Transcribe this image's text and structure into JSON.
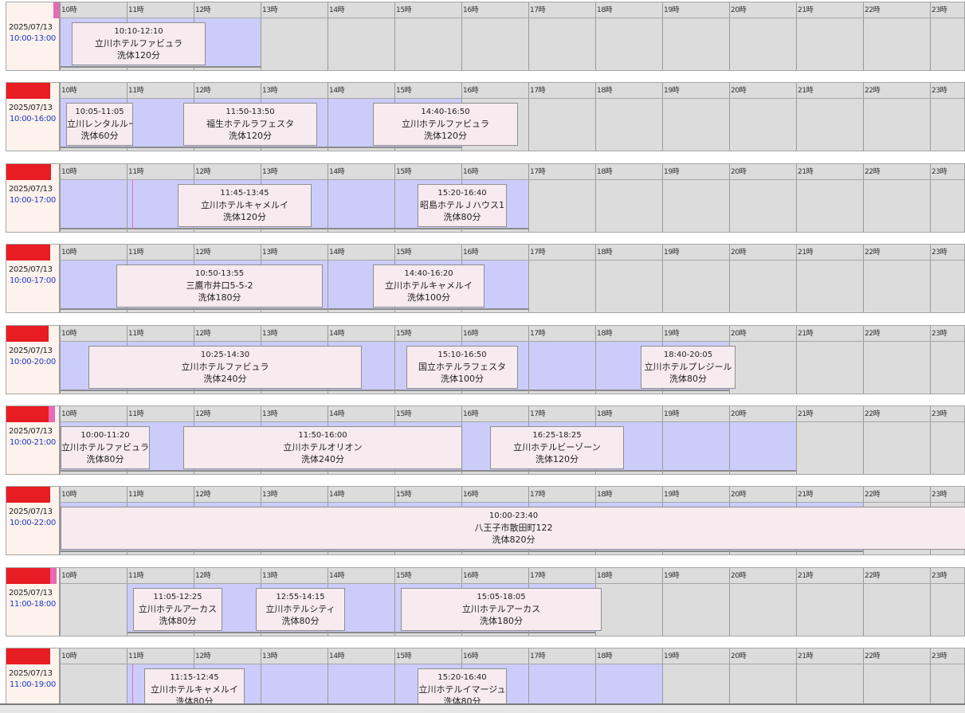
{
  "colors": {
    "available": "#ccccfb",
    "job": "#f7ebef",
    "name_bar": "#e81c23",
    "time_text": "#1e38c8"
  },
  "hours": [
    "10時",
    "11時",
    "12時",
    "13時",
    "14時",
    "15時",
    "16時",
    "17時",
    "18時",
    "19時",
    "20時",
    "21時",
    "22時",
    "23時"
  ],
  "staff": [
    {
      "date": "2025/07/13",
      "shift": "10:00-13:00",
      "name_bar": false,
      "jobs": [
        {
          "time": "10:10-12:10",
          "place": "立川ホテルファビュラ",
          "wash": "洗体120分"
        }
      ]
    },
    {
      "date": "2025/07/13",
      "shift": "10:00-16:00",
      "name_bar": true,
      "jobs": [
        {
          "time": "10:05-11:05",
          "place": "立川レンタルルー",
          "wash": "洗体60分"
        },
        {
          "time": "11:50-13:50",
          "place": "福生ホテルラフェスタ",
          "wash": "洗体120分"
        },
        {
          "time": "14:40-16:50",
          "place": "立川ホテルファビュラ",
          "wash": "洗体120分"
        }
      ]
    },
    {
      "date": "2025/07/13",
      "shift": "10:00-17:00",
      "name_bar": true,
      "jobs": [
        {
          "time": "11:45-13:45",
          "place": "立川ホテルキャメルイ",
          "wash": "洗体120分"
        },
        {
          "time": "15:20-16:40",
          "place": "昭島ホテルＪハウス1",
          "wash": "洗体80分"
        }
      ]
    },
    {
      "date": "2025/07/13",
      "shift": "10:00-17:00",
      "name_bar": true,
      "jobs": [
        {
          "time": "10:50-13:55",
          "place": "三鷹市井口5-5-2",
          "wash": "洗体180分"
        },
        {
          "time": "14:40-16:20",
          "place": "立川ホテルキャメルイ",
          "wash": "洗体100分"
        }
      ]
    },
    {
      "date": "2025/07/13",
      "shift": "10:00-20:00",
      "name_bar": true,
      "jobs": [
        {
          "time": "10:25-14:30",
          "place": "立川ホテルファビュラ",
          "wash": "洗体240分"
        },
        {
          "time": "15:10-16:50",
          "place": "国立ホテルラフェスタ",
          "wash": "洗体100分"
        },
        {
          "time": "18:40-20:05",
          "place": "立川ホテルプレジール",
          "wash": "洗体80分"
        }
      ]
    },
    {
      "date": "2025/07/13",
      "shift": "10:00-21:00",
      "name_bar": true,
      "jobs": [
        {
          "time": "10:00-11:20",
          "place": "立川ホテルファビュラ",
          "wash": "洗体80分"
        },
        {
          "time": "11:50-16:00",
          "place": "立川ホテルオリオン",
          "wash": "洗体240分"
        },
        {
          "time": "16:25-18:25",
          "place": "立川ホテルビーゾーン",
          "wash": "洗体120分"
        }
      ]
    },
    {
      "date": "2025/07/13",
      "shift": "10:00-22:00",
      "name_bar": true,
      "jobs": [
        {
          "time": "10:00-23:40",
          "place": "八王子市散田町122",
          "wash": "洗体820分"
        }
      ]
    },
    {
      "date": "2025/07/13",
      "shift": "11:00-18:00",
      "name_bar": true,
      "jobs": [
        {
          "time": "11:05-12:25",
          "place": "立川ホテルアーカス",
          "wash": "洗体80分"
        },
        {
          "time": "12:55-14:15",
          "place": "立川ホテルシティ",
          "wash": "洗体80分"
        },
        {
          "time": "15:05-18:05",
          "place": "立川ホテルアーカス",
          "wash": "洗体180分"
        }
      ]
    },
    {
      "date": "2025/07/13",
      "shift": "11:00-19:00",
      "name_bar": true,
      "jobs": [
        {
          "time": "11:15-12:45",
          "place": "立川ホテルキャメルイ",
          "wash": "洗体80分"
        },
        {
          "time": "15:20-16:40",
          "place": "立川ホテルイマージュ",
          "wash": "洗体80分"
        }
      ]
    }
  ]
}
